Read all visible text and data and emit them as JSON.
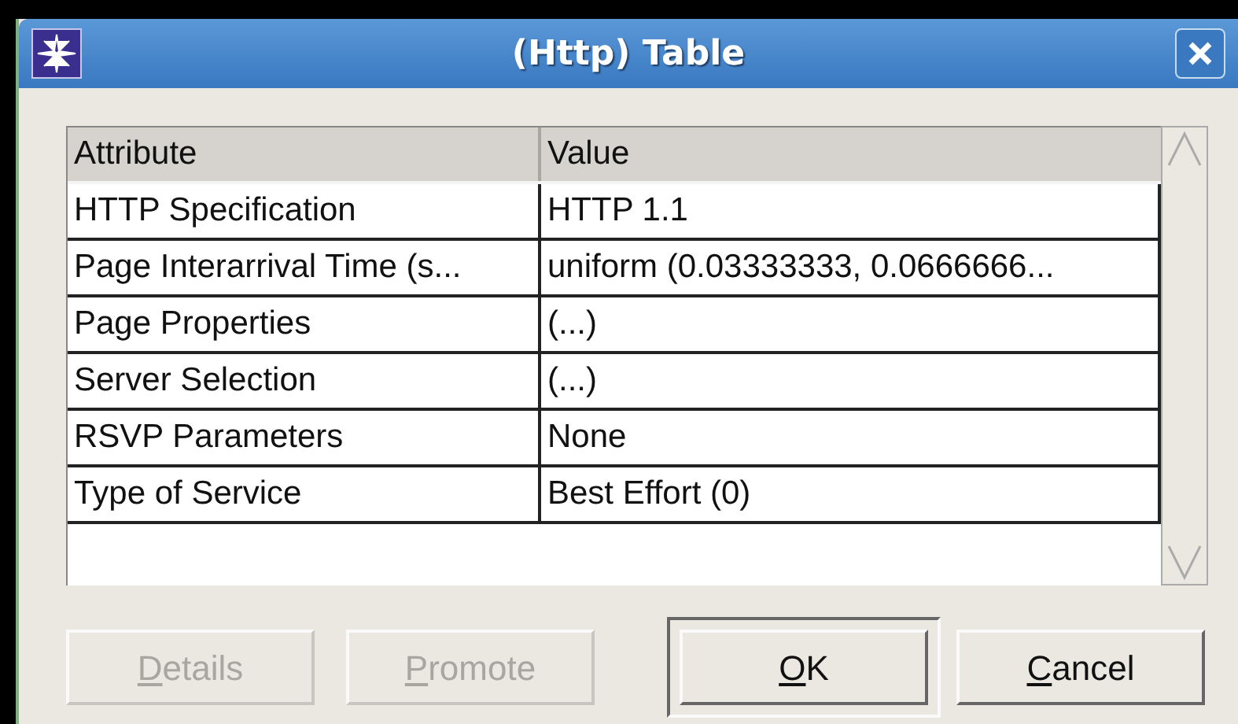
{
  "window": {
    "title": "(Http) Table"
  },
  "table": {
    "columns": [
      "Attribute",
      "Value"
    ],
    "rows": [
      {
        "attribute": "HTTP Specification",
        "value": "HTTP 1.1"
      },
      {
        "attribute": "Page Interarrival Time (s...",
        "value": "uniform (0.03333333, 0.0666666..."
      },
      {
        "attribute": "Page Properties",
        "value": "(...)"
      },
      {
        "attribute": "Server Selection",
        "value": "(...)"
      },
      {
        "attribute": "RSVP Parameters",
        "value": "None"
      },
      {
        "attribute": "Type of Service",
        "value": "Best Effort (0)"
      }
    ]
  },
  "buttons": [
    {
      "label": "Details",
      "disabled": true,
      "default": false
    },
    {
      "label": "Promote",
      "disabled": true,
      "default": false
    },
    {
      "label": "OK",
      "disabled": false,
      "default": true
    },
    {
      "label": "Cancel",
      "disabled": false,
      "default": false
    }
  ]
}
